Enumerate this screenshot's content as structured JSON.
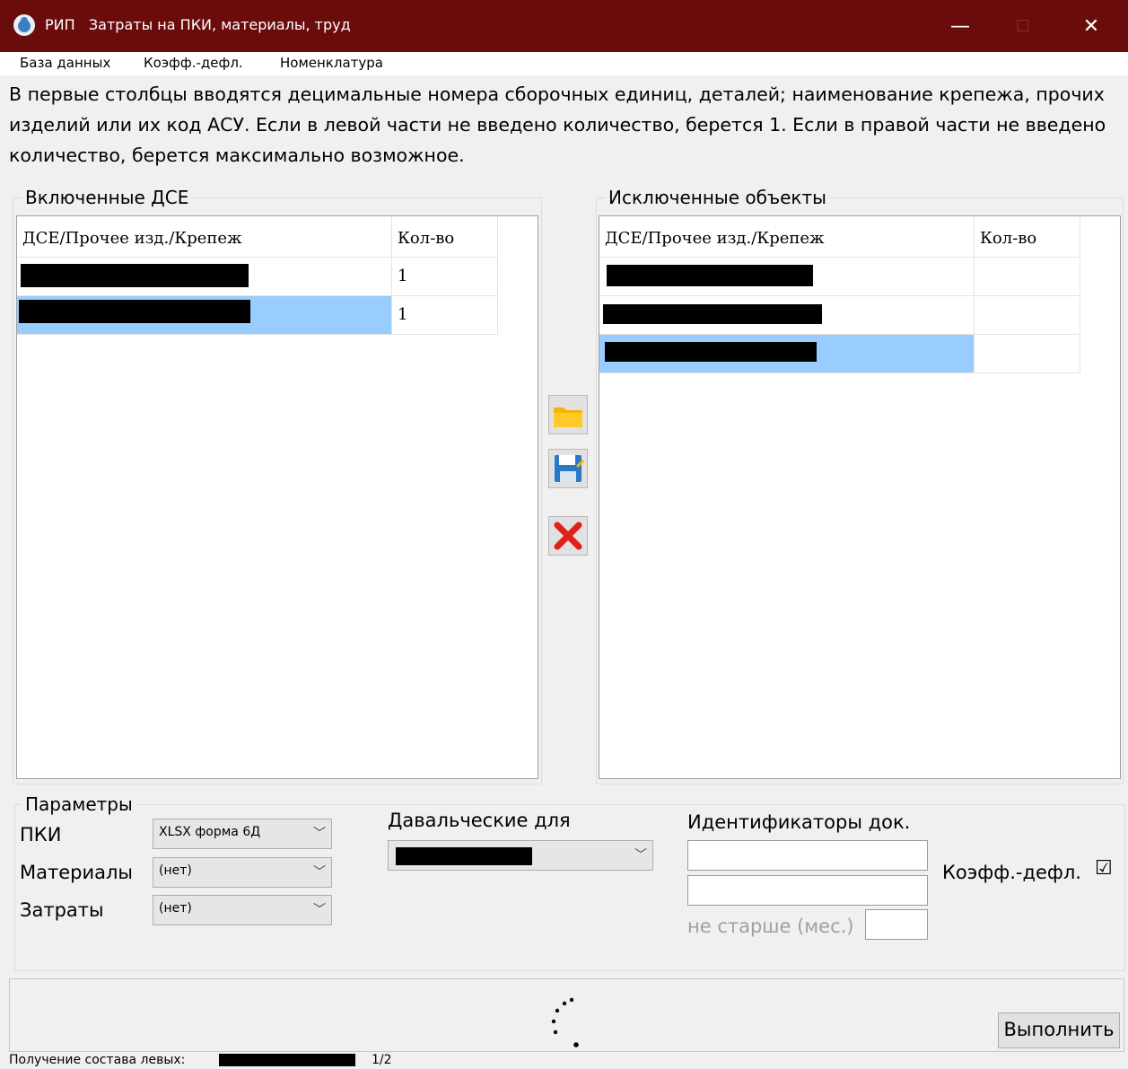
{
  "window": {
    "app_name": "РИП",
    "title": "Затраты на ПКИ, материалы, труд",
    "minimize_glyph": "—",
    "maximize_glyph": "☐",
    "close_glyph": "✕"
  },
  "menu": [
    "База данных",
    "Коэфф.-дефл.",
    "Номенклатура"
  ],
  "info_text": "В первые столбцы вводятся децимальные номера сборочных единиц, деталей; наименование крепежа, прочих изделий или их код АСУ. Если в левой части не введено количество, берется 1. Если в правой части не введено количество, берется максимально возможное.",
  "included": {
    "title": "Включенные ДСЕ",
    "columns": [
      "ДСЕ/Прочее изд./Крепеж",
      "Кол-во"
    ],
    "rows": [
      {
        "qty": "1"
      },
      {
        "qty": "1"
      }
    ]
  },
  "excluded": {
    "title": "Исключенные объекты",
    "columns": [
      "ДСЕ/Прочее изд./Крепеж",
      "Кол-во"
    ],
    "rows": [
      {
        "qty": ""
      },
      {
        "qty": ""
      },
      {
        "qty": ""
      }
    ]
  },
  "icons": {
    "open": "folder-icon",
    "save": "save-icon",
    "delete": "delete-x-icon"
  },
  "params": {
    "title": "Параметры",
    "pki_label": "ПКИ",
    "pki_value": "XLSX форма 6Д",
    "materials_label": "Материалы",
    "materials_value": "(нет)",
    "costs_label": "Затраты",
    "costs_value": "(нет)"
  },
  "toll": {
    "label": "Давальческие для"
  },
  "doc_ids": {
    "label": "Идентификаторы док.",
    "age_label": "не старше (мес.)"
  },
  "deflator": {
    "label": "Коэфф.-дефл.",
    "checkbox_glyph": "☑"
  },
  "run_button": "Выполнить",
  "status": {
    "prefix": "Получение состава левых:",
    "counter": "1/2"
  },
  "colors": {
    "titlebar": "#6b0c0c",
    "selection": "#99ccff",
    "delete": "#e0201c",
    "folder": "#f5b400"
  }
}
